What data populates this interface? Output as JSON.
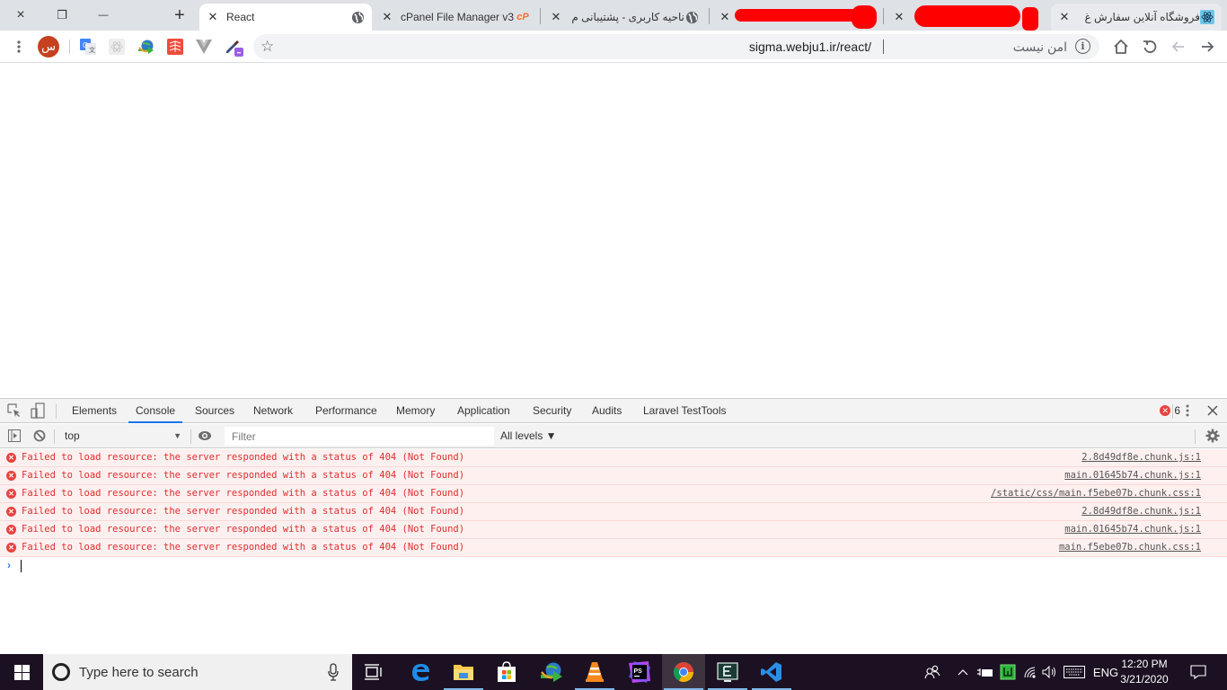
{
  "window": {
    "close_icon": "×",
    "restore_icon": "❐",
    "minimize_icon": "—",
    "new_tab_icon": "+"
  },
  "tabs": [
    {
      "title": "React",
      "icon": "globe-icon",
      "active": true
    },
    {
      "title": "cPanel File Manager v3",
      "icon": "cpanel-icon",
      "active": false
    },
    {
      "title": "ناحیه کاربری - پشتیبانی م",
      "icon": "globe-icon",
      "active": false
    },
    {
      "title": "[redacted]",
      "icon": "",
      "active": false
    },
    {
      "title": "[redacted]",
      "icon": "",
      "active": false
    },
    {
      "title": "فروشگاه آنلاین سفارش غ",
      "icon": "react-icon",
      "active": false
    }
  ],
  "toolbar": {
    "url": "sigma.webju1.ir/react/",
    "security_label": "امن نیست",
    "profile_initial": "س",
    "extensions": [
      "google-translate-icon",
      "react-devtools-icon",
      "idm-icon",
      "laravel-icon",
      "vue-devtools-icon",
      "color-picker-icon"
    ]
  },
  "devtools": {
    "tabs": [
      "Elements",
      "Console",
      "Sources",
      "Network",
      "Performance",
      "Memory",
      "Application",
      "Security",
      "Audits",
      "Laravel TestTools"
    ],
    "active_tab": "Console",
    "error_count": "6",
    "context": "top",
    "filter_placeholder": "Filter",
    "levels_label": "All levels ▼",
    "messages": [
      {
        "text": "Failed to load resource: the server responded with a status of 404 (Not Found)",
        "source": "2.8d49df8e.chunk.js:1"
      },
      {
        "text": "Failed to load resource: the server responded with a status of 404 (Not Found)",
        "source": "main.01645b74.chunk.js:1"
      },
      {
        "text": "Failed to load resource: the server responded with a status of 404 (Not Found)",
        "source": "/static/css/main.f5ebe07b.chunk.css:1"
      },
      {
        "text": "Failed to load resource: the server responded with a status of 404 (Not Found)",
        "source": "2.8d49df8e.chunk.js:1"
      },
      {
        "text": "Failed to load resource: the server responded with a status of 404 (Not Found)",
        "source": "main.01645b74.chunk.js:1"
      },
      {
        "text": "Failed to load resource: the server responded with a status of 404 (Not Found)",
        "source": "main.f5ebe07b.chunk.css:1"
      }
    ]
  },
  "taskbar": {
    "search_placeholder": "Type here to search",
    "apps": [
      "task-view",
      "edge",
      "file-explorer",
      "microsoft-store",
      "internet-download-manager",
      "vlc",
      "phpstorm",
      "chrome",
      "editor",
      "vscode"
    ],
    "language": "ENG",
    "time": "12:20 PM",
    "date": "3/21/2020"
  }
}
